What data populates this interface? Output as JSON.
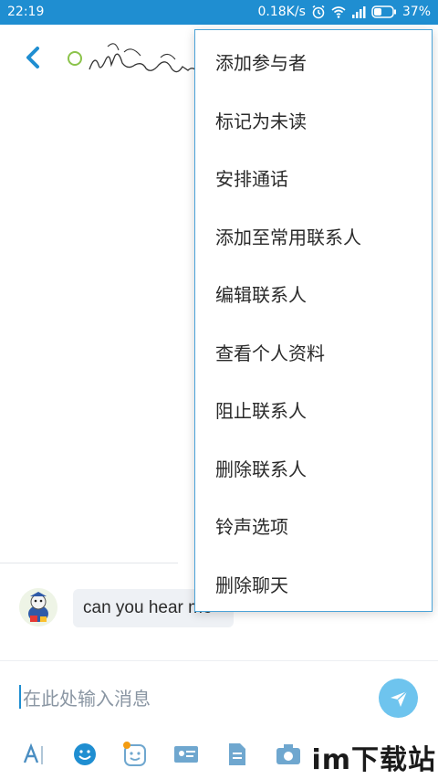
{
  "status": {
    "time": "22:19",
    "speed": "0.18K/s",
    "battery": "37%"
  },
  "header": {
    "back_icon": "chevron-left-icon",
    "presence_color": "#8bc34a"
  },
  "menu": {
    "items": [
      "添加参与者",
      "标记为未读",
      "安排通话",
      "添加至常用联系人",
      "编辑联系人",
      "查看个人资料",
      "阻止联系人",
      "删除联系人",
      "铃声选项",
      "删除聊天"
    ]
  },
  "chat": {
    "message": "can you hear me"
  },
  "composer": {
    "placeholder": "在此处输入消息"
  },
  "toolbar": {
    "icons": [
      "text-format-icon",
      "emoticon-icon",
      "sticker-icon",
      "contact-card-icon",
      "file-icon",
      "camera-icon"
    ]
  },
  "watermark": "im下载站",
  "colors": {
    "accent": "#1f8ed1",
    "send_button": "#6ec4ee",
    "menu_border": "#4aa3d8"
  }
}
